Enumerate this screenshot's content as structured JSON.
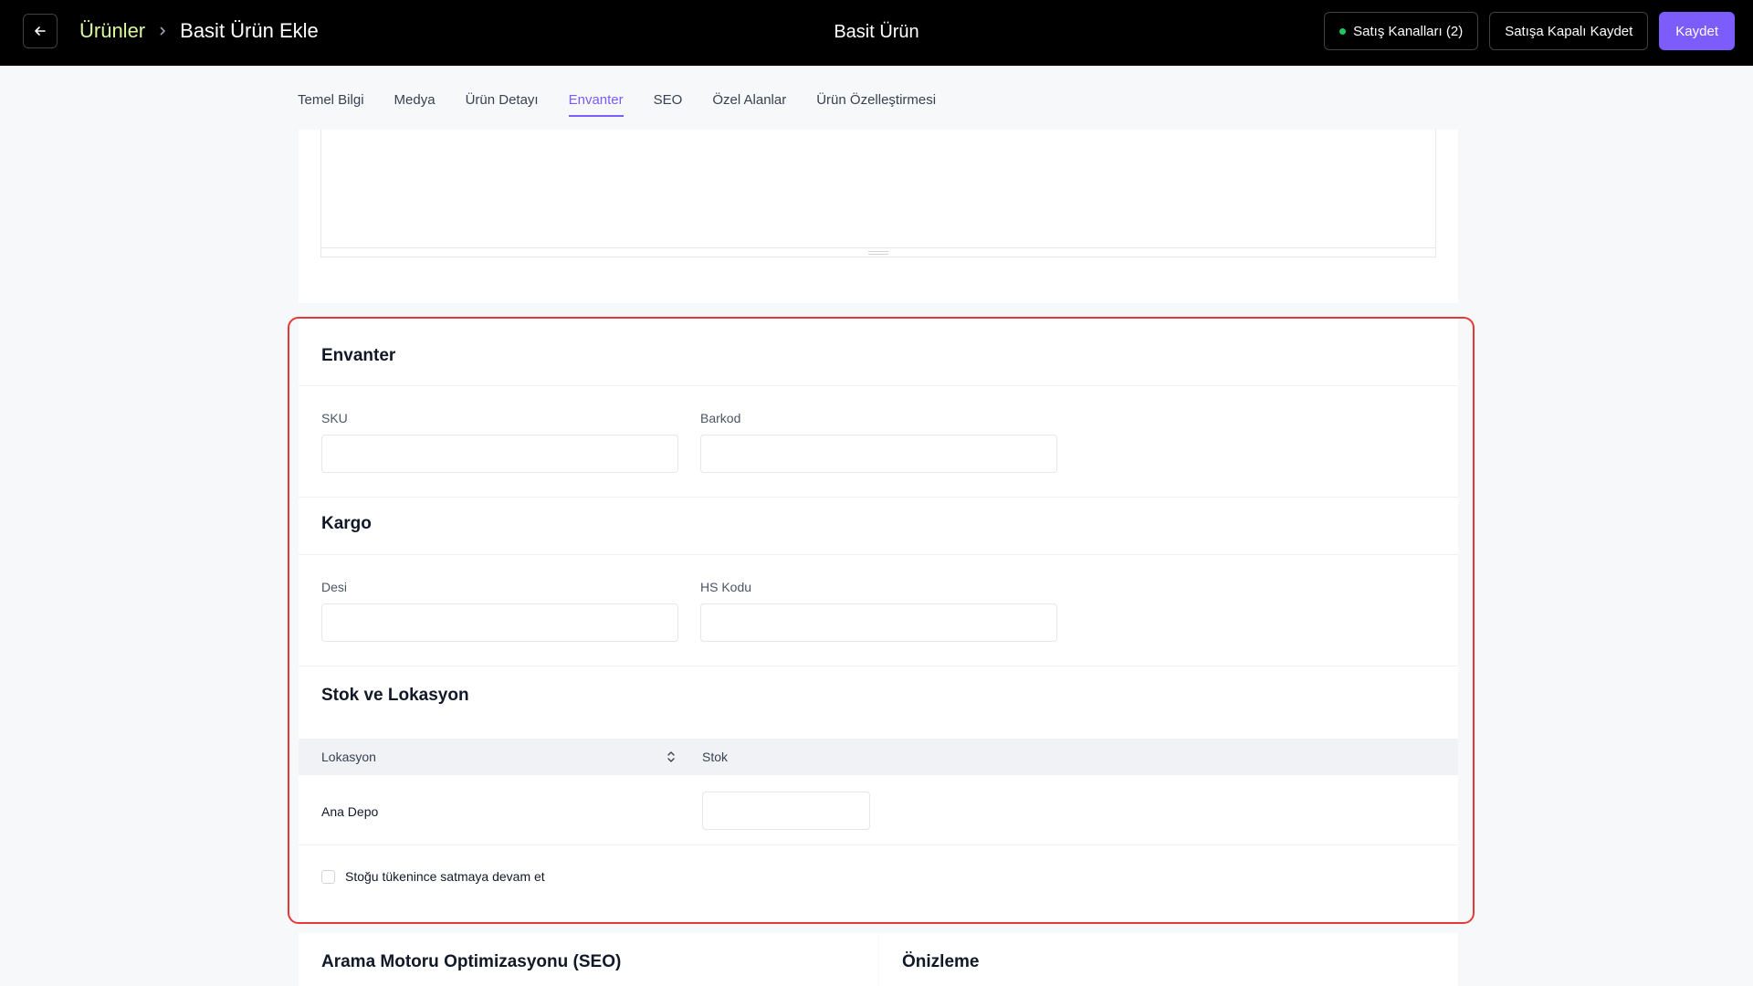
{
  "header": {
    "back_label": "←",
    "breadcrumb_root": "Ürünler",
    "breadcrumb_current": "Basit Ürün Ekle",
    "title": "Basit Ürün",
    "sales_channels_label": "Satış Kanalları (2)",
    "save_closed_label": "Satışa Kapalı Kaydet",
    "save_label": "Kaydet"
  },
  "tabs": [
    {
      "label": "Temel Bilgi"
    },
    {
      "label": "Medya"
    },
    {
      "label": "Ürün Detayı"
    },
    {
      "label": "Envanter",
      "active": true
    },
    {
      "label": "SEO"
    },
    {
      "label": "Özel Alanlar"
    },
    {
      "label": "Ürün Özelleştirmesi"
    }
  ],
  "inventory": {
    "title": "Envanter",
    "sku_label": "SKU",
    "sku_value": "",
    "barcode_label": "Barkod",
    "barcode_value": ""
  },
  "shipping": {
    "title": "Kargo",
    "desi_label": "Desi",
    "desi_value": "",
    "hs_label": "HS Kodu",
    "hs_value": ""
  },
  "stock": {
    "title": "Stok ve Lokasyon",
    "columns": [
      "Lokasyon",
      "Stok"
    ],
    "rows": [
      {
        "location": "Ana Depo",
        "stock": ""
      }
    ],
    "continue_selling_label": "Stoğu tükenince satmaya devam et",
    "continue_selling_checked": false
  },
  "bottom": {
    "seo_title": "Arama Motoru Optimizasyonu (SEO)",
    "preview_title": "Önizleme"
  },
  "colors": {
    "accent": "#7c5cfa",
    "highlight_border": "#e53935",
    "breadcrumb_root": "#d9f99d",
    "status_dot": "#22c55e"
  }
}
